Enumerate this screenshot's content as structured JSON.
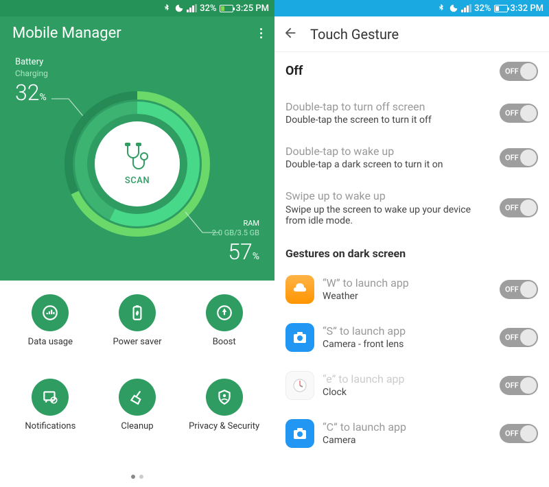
{
  "left": {
    "status": {
      "battery_pct": "32%",
      "time": "3:25 PM"
    },
    "title": "Mobile Manager",
    "battery": {
      "label": "Battery",
      "status": "Charging",
      "value": "32",
      "unit": "%"
    },
    "ram": {
      "label": "RAM",
      "detail": "2.0 GB/3.5 GB",
      "value": "57",
      "unit": "%"
    },
    "scan": "SCAN",
    "grid": [
      {
        "label": "Data usage"
      },
      {
        "label": "Power saver"
      },
      {
        "label": "Boost"
      },
      {
        "label": "Notifications"
      },
      {
        "label": "Cleanup"
      },
      {
        "label": "Privacy & Security"
      }
    ],
    "page_dots": {
      "active": 0,
      "count": 2
    }
  },
  "right": {
    "status": {
      "battery_pct": "32%",
      "time": "3:32 PM"
    },
    "title": "Touch Gesture",
    "master": {
      "label": "Off",
      "toggle": "OFF"
    },
    "items": [
      {
        "label": "Double-tap to turn off screen",
        "sub": "Double-tap the screen to turn it off",
        "toggle": "OFF"
      },
      {
        "label": "Double-tap to wake up",
        "sub": "Double-tap a dark screen to turn it on",
        "toggle": "OFF"
      },
      {
        "label": "Swipe up to wake up",
        "sub": "Swipe up the screen to wake up your device from idle mode.",
        "toggle": "OFF"
      }
    ],
    "section": "Gestures on dark screen",
    "gestures": [
      {
        "label": "“W” to launch app",
        "sub": "Weather",
        "toggle": "OFF",
        "icon": "weather"
      },
      {
        "label": "“S” to launch app",
        "sub": "Camera - front lens",
        "toggle": "OFF",
        "icon": "camera"
      },
      {
        "label": "“e” to launch app",
        "sub": "Clock",
        "toggle": "OFF",
        "icon": "clock"
      },
      {
        "label": "“C” to launch app",
        "sub": "Camera",
        "toggle": "OFF",
        "icon": "camera"
      }
    ]
  }
}
